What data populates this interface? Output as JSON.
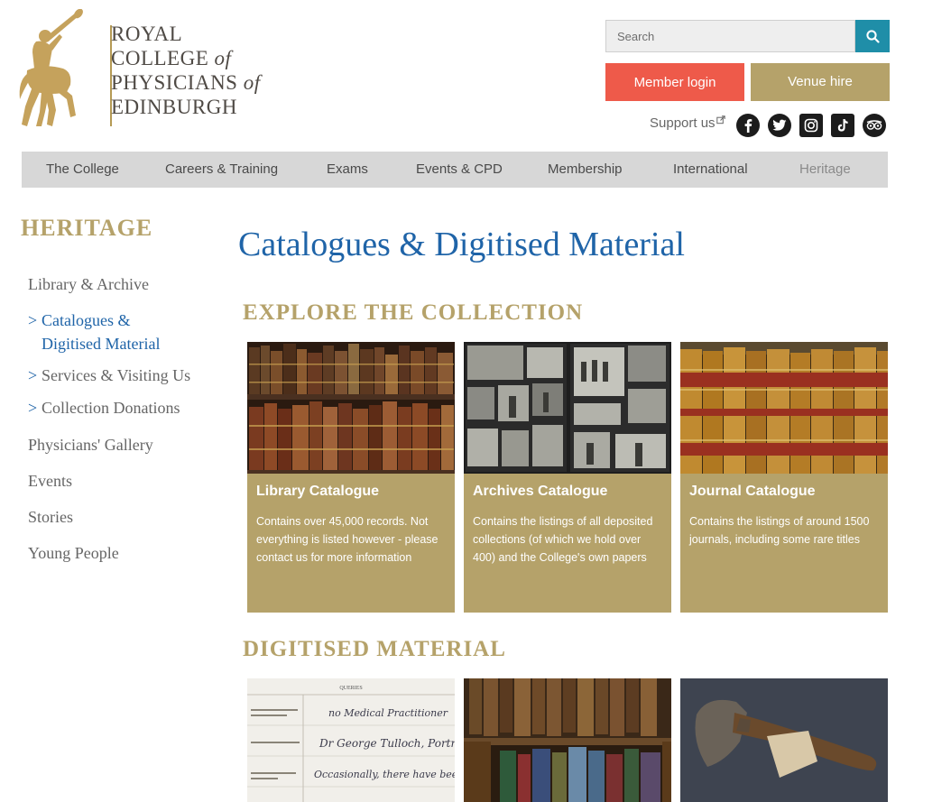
{
  "logo": {
    "line1": "ROYAL",
    "line2_main": "COLLEGE ",
    "line2_of": "of",
    "line3_main": "PHYSICIANS ",
    "line3_of": "of",
    "line4": "EDINBURGH"
  },
  "search": {
    "placeholder": "Search"
  },
  "header": {
    "member_login": "Member login",
    "venue_hire": "Venue hire",
    "support_us": "Support us"
  },
  "social": [
    "facebook-icon",
    "twitter-icon",
    "instagram-icon",
    "tiktok-icon",
    "tripadvisor-icon"
  ],
  "nav": {
    "items": [
      "The College",
      "Careers & Training",
      "Exams",
      "Events & CPD",
      "Membership",
      "International",
      "Heritage"
    ],
    "active": "Heritage"
  },
  "sidebar": {
    "title": "HERITAGE",
    "library_archive": "Library & Archive",
    "subitems": [
      "Catalogues & Digitised Material",
      "Services & Visiting Us",
      "Collection Donations"
    ],
    "sub_marker": ">",
    "catalogues_line1": "Catalogues &",
    "catalogues_line2": "Digitised Material",
    "links": [
      "Physicians' Gallery",
      "Events",
      "Stories",
      "Young People"
    ]
  },
  "main": {
    "page_title": "Catalogues & Digitised Material",
    "explore_heading": "EXPLORE THE COLLECTION",
    "digitised_heading": "DIGITISED MATERIAL",
    "cards": [
      {
        "title": "Library Catalogue",
        "description": "Contains over 45,000 records. Not everything is listed however - please contact us for more information"
      },
      {
        "title": "Archives Catalogue",
        "description": "Contains the listings of all deposited collections (of which we hold over 400) and the College's own papers"
      },
      {
        "title": "Journal Catalogue",
        "description": "Contains the listings of around 1500 journals, including some rare titles"
      }
    ],
    "document_image": {
      "header": "QUERIES",
      "line1": "no Medical Practitioner",
      "line2": "Dr George Tulloch, Portree",
      "line3": "Occasionally, there have been some"
    }
  },
  "colors": {
    "gold": "#b5a26a",
    "blue": "#1f64a8",
    "search_button": "#1f8ea8",
    "member_button": "#ee5a4a",
    "nav_bg": "#d7d7d7"
  }
}
